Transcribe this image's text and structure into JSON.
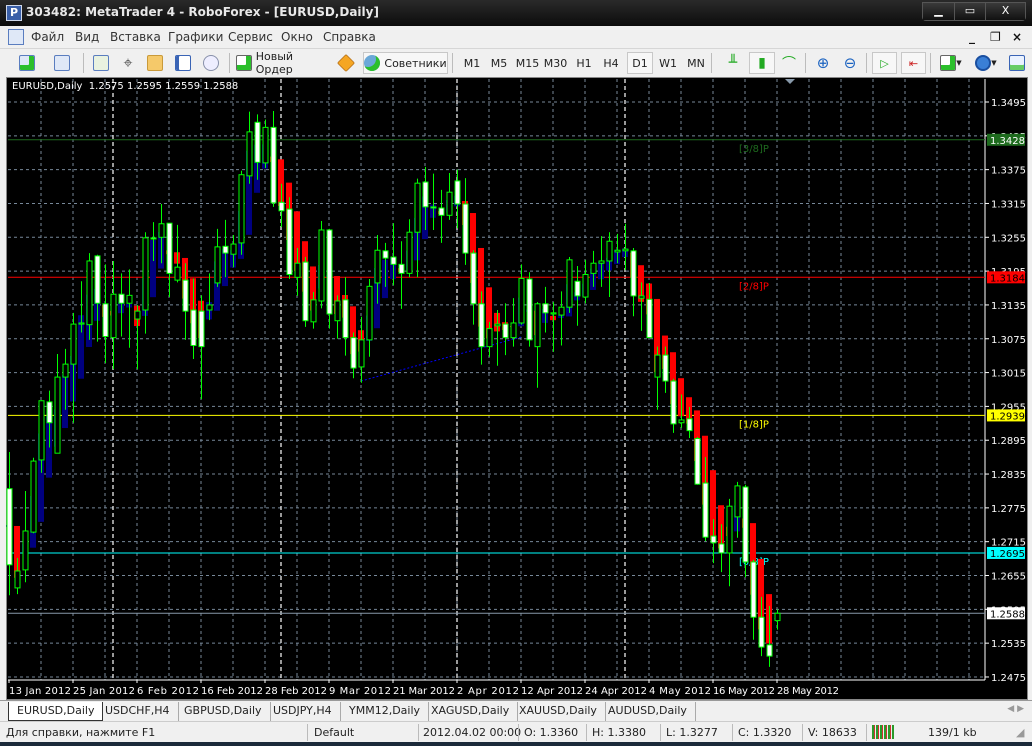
{
  "window": {
    "title": "303482: MetaTrader 4 - RoboForex - [EURUSD,Daily]",
    "app_icon_letter": "P",
    "controls": {
      "minimize": "▁",
      "maximize": "▭",
      "close": "X"
    }
  },
  "menu": {
    "items": [
      "Файл",
      "Вид",
      "Вставка",
      "Графики",
      "Сервис",
      "Окно",
      "Справка"
    ],
    "mdi_controls": {
      "minimize": "_",
      "restore": "❐",
      "close": "×"
    }
  },
  "toolbar": {
    "new_order_label": "Новый Ордер",
    "experts_label": "Советники",
    "timeframes": [
      "M1",
      "M5",
      "M15",
      "M30",
      "H1",
      "H4",
      "D1",
      "W1",
      "MN"
    ],
    "active_timeframe": "D1"
  },
  "chart": {
    "header": "EURUSD,Daily  1.2575 1.2595 1.2559 1.2588"
  },
  "chart_data": {
    "type": "candlestick",
    "symbol": "EURUSD",
    "period": "Daily",
    "ylim": [
      1.2457,
      1.3535
    ],
    "price_ticks": [
      "1.3495",
      "1.3435",
      "1.3375",
      "1.3315",
      "1.3255",
      "1.3195",
      "1.3135",
      "1.3075",
      "1.3015",
      "1.2955",
      "1.2895",
      "1.2835",
      "1.2775",
      "1.2715",
      "1.2655",
      "1.2595",
      "1.2535",
      "1.2475"
    ],
    "time_labels": [
      {
        "bar": 0,
        "label": "13 Jan 2012"
      },
      {
        "bar": 8,
        "label": "25 Jan 2012"
      },
      {
        "bar": 16,
        "label": "6 Feb 2012"
      },
      {
        "bar": 24,
        "label": "16 Feb 2012"
      },
      {
        "bar": 32,
        "label": "28 Feb 2012"
      },
      {
        "bar": 40,
        "label": "9 Mar 2012"
      },
      {
        "bar": 48,
        "label": "21 Mar 2012"
      },
      {
        "bar": 56,
        "label": "2 Apr 2012"
      },
      {
        "bar": 64,
        "label": "12 Apr 2012"
      },
      {
        "bar": 72,
        "label": "24 Apr 2012"
      },
      {
        "bar": 80,
        "label": "4 May 2012"
      },
      {
        "bar": 88,
        "label": "16 May 2012"
      },
      {
        "bar": 96,
        "label": "28 May 2012"
      }
    ],
    "period_separators": [
      13,
      34,
      56,
      77
    ],
    "bars_ohlc": [
      [
        1.2809,
        1.2874,
        1.262,
        1.2674
      ],
      [
        1.2633,
        1.2686,
        1.2622,
        1.2663
      ],
      [
        1.2665,
        1.2805,
        1.2643,
        1.2734
      ],
      [
        1.2732,
        1.2864,
        1.273,
        1.2858
      ],
      [
        1.286,
        1.2966,
        1.2837,
        1.2965
      ],
      [
        1.2963,
        1.2983,
        1.2882,
        1.2926
      ],
      [
        1.2872,
        1.3048,
        1.2872,
        1.3007
      ],
      [
        1.3007,
        1.3057,
        1.2949,
        1.303
      ],
      [
        1.303,
        1.3121,
        1.2926,
        1.3101
      ],
      [
        1.3101,
        1.3177,
        1.3086,
        1.3103
      ],
      [
        1.31,
        1.3227,
        1.3073,
        1.3213
      ],
      [
        1.3222,
        1.3224,
        1.307,
        1.3138
      ],
      [
        1.3137,
        1.3207,
        1.3032,
        1.3079
      ],
      [
        1.3077,
        1.3213,
        1.3021,
        1.3154
      ],
      [
        1.3154,
        1.3191,
        1.3079,
        1.3138
      ],
      [
        1.3138,
        1.3198,
        1.3059,
        1.3152
      ],
      [
        1.311,
        1.3135,
        1.3021,
        1.3124
      ],
      [
        1.3126,
        1.3264,
        1.3084,
        1.3254
      ],
      [
        1.3254,
        1.3282,
        1.3213,
        1.3252
      ],
      [
        1.3255,
        1.3314,
        1.3209,
        1.3279
      ],
      [
        1.328,
        1.328,
        1.3149,
        1.3191
      ],
      [
        1.3179,
        1.3277,
        1.3175,
        1.3202
      ],
      [
        1.3179,
        1.3209,
        1.3073,
        1.3124
      ],
      [
        1.3126,
        1.3182,
        1.3039,
        1.3063
      ],
      [
        1.3124,
        1.3152,
        1.2968,
        1.3061
      ],
      [
        1.3126,
        1.3191,
        1.3108,
        1.3135
      ],
      [
        1.3174,
        1.327,
        1.3167,
        1.3238
      ],
      [
        1.3239,
        1.3286,
        1.3184,
        1.3227
      ],
      [
        1.3225,
        1.3259,
        1.3202,
        1.3243
      ],
      [
        1.3245,
        1.3373,
        1.3224,
        1.3366
      ],
      [
        1.3364,
        1.3478,
        1.335,
        1.3442
      ],
      [
        1.3459,
        1.3473,
        1.3357,
        1.3388
      ],
      [
        1.3387,
        1.3464,
        1.3378,
        1.345
      ],
      [
        1.345,
        1.3479,
        1.3309,
        1.3316
      ],
      [
        1.3317,
        1.335,
        1.3273,
        1.3302
      ],
      [
        1.3305,
        1.3326,
        1.3181,
        1.3189
      ],
      [
        1.3184,
        1.3236,
        1.3151,
        1.3209
      ],
      [
        1.3211,
        1.322,
        1.3096,
        1.3107
      ],
      [
        1.3105,
        1.3158,
        1.3093,
        1.3144
      ],
      [
        1.3142,
        1.3284,
        1.3129,
        1.3268
      ],
      [
        1.3268,
        1.327,
        1.3093,
        1.3119
      ],
      [
        1.3107,
        1.3152,
        1.3075,
        1.3142
      ],
      [
        1.3144,
        1.3184,
        1.3045,
        1.3077
      ],
      [
        1.3077,
        1.3086,
        1.3005,
        1.3023
      ],
      [
        1.3025,
        1.3114,
        1.2997,
        1.3073
      ],
      [
        1.3073,
        1.3181,
        1.3043,
        1.3168
      ],
      [
        1.3174,
        1.3259,
        1.3137,
        1.3232
      ],
      [
        1.3231,
        1.3245,
        1.3167,
        1.3218
      ],
      [
        1.322,
        1.328,
        1.317,
        1.3207
      ],
      [
        1.3207,
        1.3248,
        1.3128,
        1.3191
      ],
      [
        1.3191,
        1.3287,
        1.3184,
        1.3264
      ],
      [
        1.3264,
        1.3359,
        1.3184,
        1.3351
      ],
      [
        1.3353,
        1.338,
        1.3268,
        1.3309
      ],
      [
        1.3309,
        1.3368,
        1.3268,
        1.3307
      ],
      [
        1.3307,
        1.3339,
        1.3245,
        1.3294
      ],
      [
        1.3294,
        1.3369,
        1.3286,
        1.3335
      ],
      [
        1.3355,
        1.3375,
        1.3271,
        1.3314
      ],
      [
        1.3314,
        1.336,
        1.3206,
        1.3227
      ],
      [
        1.3227,
        1.3232,
        1.31,
        1.3137
      ],
      [
        1.3137,
        1.3159,
        1.3029,
        1.3061
      ],
      [
        1.3061,
        1.3105,
        1.3043,
        1.3093
      ],
      [
        1.3098,
        1.3126,
        1.3027,
        1.3101
      ],
      [
        1.3101,
        1.3138,
        1.3046,
        1.3077
      ],
      [
        1.3077,
        1.3147,
        1.3061,
        1.3103
      ],
      [
        1.3103,
        1.3207,
        1.31,
        1.3182
      ],
      [
        1.3181,
        1.3193,
        1.3061,
        1.3073
      ],
      [
        1.3061,
        1.314,
        1.2988,
        1.3137
      ],
      [
        1.3137,
        1.3167,
        1.3086,
        1.3121
      ],
      [
        1.3119,
        1.314,
        1.3052,
        1.3121
      ],
      [
        1.3117,
        1.3159,
        1.3063,
        1.3131
      ],
      [
        1.3131,
        1.322,
        1.3121,
        1.3215
      ],
      [
        1.3177,
        1.3204,
        1.3098,
        1.3151
      ],
      [
        1.3149,
        1.3215,
        1.3138,
        1.3189
      ],
      [
        1.3191,
        1.3231,
        1.3167,
        1.3209
      ],
      [
        1.3209,
        1.3257,
        1.3167,
        1.3213
      ],
      [
        1.3213,
        1.3264,
        1.3149,
        1.3248
      ],
      [
        1.3229,
        1.3261,
        1.3209,
        1.3232
      ],
      [
        1.3231,
        1.3279,
        1.3197,
        1.3234
      ],
      [
        1.3231,
        1.3236,
        1.3115,
        1.3151
      ],
      [
        1.3147,
        1.3175,
        1.3089,
        1.3151
      ],
      [
        1.3145,
        1.3174,
        1.3077,
        1.3077
      ],
      [
        1.3007,
        1.3061,
        1.2949,
        1.3046
      ],
      [
        1.3046,
        1.3061,
        1.2979,
        1.3
      ],
      [
        1.3,
        1.3004,
        1.2908,
        1.2924
      ],
      [
        1.2926,
        1.2976,
        1.2917,
        1.2931
      ],
      [
        1.2933,
        1.2954,
        1.2899,
        1.2912
      ],
      [
        1.2898,
        1.2901,
        1.2816,
        1.2817
      ],
      [
        1.2819,
        1.2865,
        1.2716,
        1.2723
      ],
      [
        1.2725,
        1.2755,
        1.2677,
        1.2713
      ],
      [
        1.2711,
        1.2746,
        1.2661,
        1.2695
      ],
      [
        1.2695,
        1.2791,
        1.2636,
        1.2778
      ],
      [
        1.2759,
        1.2821,
        1.2722,
        1.2814
      ],
      [
        1.2812,
        1.2816,
        1.2652,
        1.2679
      ],
      [
        1.2679,
        1.2683,
        1.2541,
        1.2581
      ],
      [
        1.2581,
        1.2617,
        1.2512,
        1.2528
      ],
      [
        1.2532,
        1.2601,
        1.2493,
        1.2512
      ],
      [
        1.2575,
        1.2595,
        1.2559,
        1.2588
      ]
    ],
    "levels": [
      {
        "label": "[3/8]P",
        "price": "1.3428",
        "color": "#1e6b1e",
        "text_color": "#ffffff"
      },
      {
        "label": "[2/8]P",
        "price": "1.3184",
        "color": "#ff0000",
        "text_color": "#000000"
      },
      {
        "label": "[1/8]P",
        "price": "1.2939",
        "color": "#ffff00",
        "text_color": "#000000"
      },
      {
        "label": "[0/8]P",
        "price": "1.2695",
        "color": "#00ffff",
        "text_color": "#000000"
      }
    ],
    "current_price": {
      "price": "1.2588",
      "color": "#ffffff"
    },
    "trendline": {
      "from": {
        "bar": 44,
        "price": 1.3
      },
      "to": {
        "bar": 64,
        "price": 1.3078
      },
      "color": "#0000ff"
    },
    "colors": {
      "bull_fill": "#000000",
      "bear_fill": "#ffffff",
      "candle_line": "#00ff00",
      "grid": "#778899",
      "overlay_up": "#000080",
      "overlay_down": "#ff0000"
    }
  },
  "tabs": [
    "EURUSD,Daily",
    "USDCHF,H4",
    "GBPUSD,Daily",
    "USDJPY,H4",
    "YMM12,Daily",
    "XAGUSD,Daily",
    "XAUUSD,Daily",
    "AUDUSD,Daily"
  ],
  "active_tab": "EURUSD,Daily",
  "status": {
    "help": "Для справки, нажмите F1",
    "profile": "Default",
    "datetime": "2012.04.02 00:00",
    "open": "O: 1.3360",
    "high": "H: 1.3380",
    "low": "L: 1.3277",
    "close": "C: 1.3320",
    "volume": "V: 18633",
    "traffic": "139/1 kb"
  }
}
